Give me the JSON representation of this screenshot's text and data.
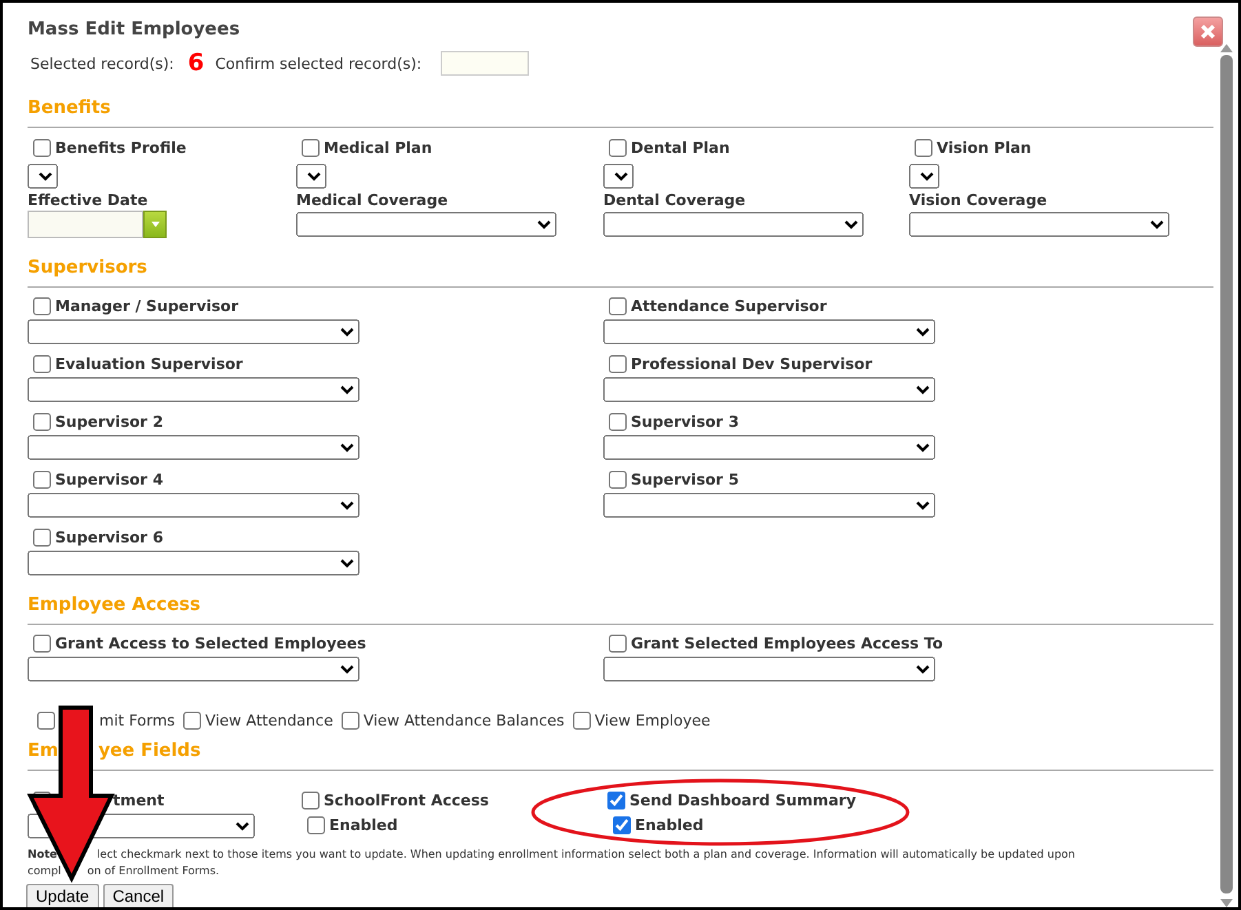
{
  "dialog": {
    "title": "Mass Edit Employees"
  },
  "records": {
    "label": "Selected record(s):",
    "count": "6",
    "confirm_label": "Confirm selected record(s):"
  },
  "benefits": {
    "heading": "Benefits",
    "columns": [
      {
        "label": "Benefits Profile",
        "checked": false,
        "field_label": "Effective Date",
        "kind": "date"
      },
      {
        "label": "Medical Plan",
        "checked": false,
        "field_label": "Medical Coverage",
        "kind": "select"
      },
      {
        "label": "Dental Plan",
        "checked": false,
        "field_label": "Dental Coverage",
        "kind": "select"
      },
      {
        "label": "Vision Plan",
        "checked": false,
        "field_label": "Vision Coverage",
        "kind": "select"
      }
    ]
  },
  "supervisors": {
    "heading": "Supervisors",
    "items": [
      {
        "label": "Manager / Supervisor",
        "checked": false
      },
      {
        "label": "Attendance Supervisor",
        "checked": false
      },
      {
        "label": "Evaluation Supervisor",
        "checked": false
      },
      {
        "label": "Professional Dev Supervisor",
        "checked": false
      },
      {
        "label": "Supervisor 2",
        "checked": false
      },
      {
        "label": "Supervisor 3",
        "checked": false
      },
      {
        "label": "Supervisor 4",
        "checked": false
      },
      {
        "label": "Supervisor 5",
        "checked": false
      },
      {
        "label": "Supervisor 6",
        "checked": false
      }
    ]
  },
  "employee_access": {
    "heading": "Employee Access",
    "grants": [
      {
        "label": "Grant Access to Selected Employees",
        "checked": false
      },
      {
        "label": "Grant Selected Employees Access To",
        "checked": false
      }
    ],
    "options": [
      {
        "label": "mit Forms",
        "checked": false
      },
      {
        "label": "View Attendance",
        "checked": false
      },
      {
        "label": "View Attendance Balances",
        "checked": false
      },
      {
        "label": "View Employee",
        "checked": false
      }
    ]
  },
  "employee_fields": {
    "heading_parts": [
      "Em",
      "yee Fields"
    ],
    "items": [
      {
        "kind": "select",
        "label": "tment",
        "checked": false
      },
      {
        "kind": "pair",
        "label": "SchoolFront Access",
        "checked": false,
        "sub_label": "Enabled",
        "sub_checked": false
      },
      {
        "kind": "pair",
        "label": "Send Dashboard Summary",
        "checked": true,
        "sub_label": "Enabled",
        "sub_checked": true
      }
    ]
  },
  "note": {
    "bold": "Note",
    "line1": "lect checkmark next to those items you want to update. When updating enrollment information select both a plan and coverage. Information will automatically be updated upon",
    "line2_parts": [
      "compl",
      "on of Enrollment Forms."
    ]
  },
  "buttons": [
    "Update",
    "Cancel"
  ]
}
